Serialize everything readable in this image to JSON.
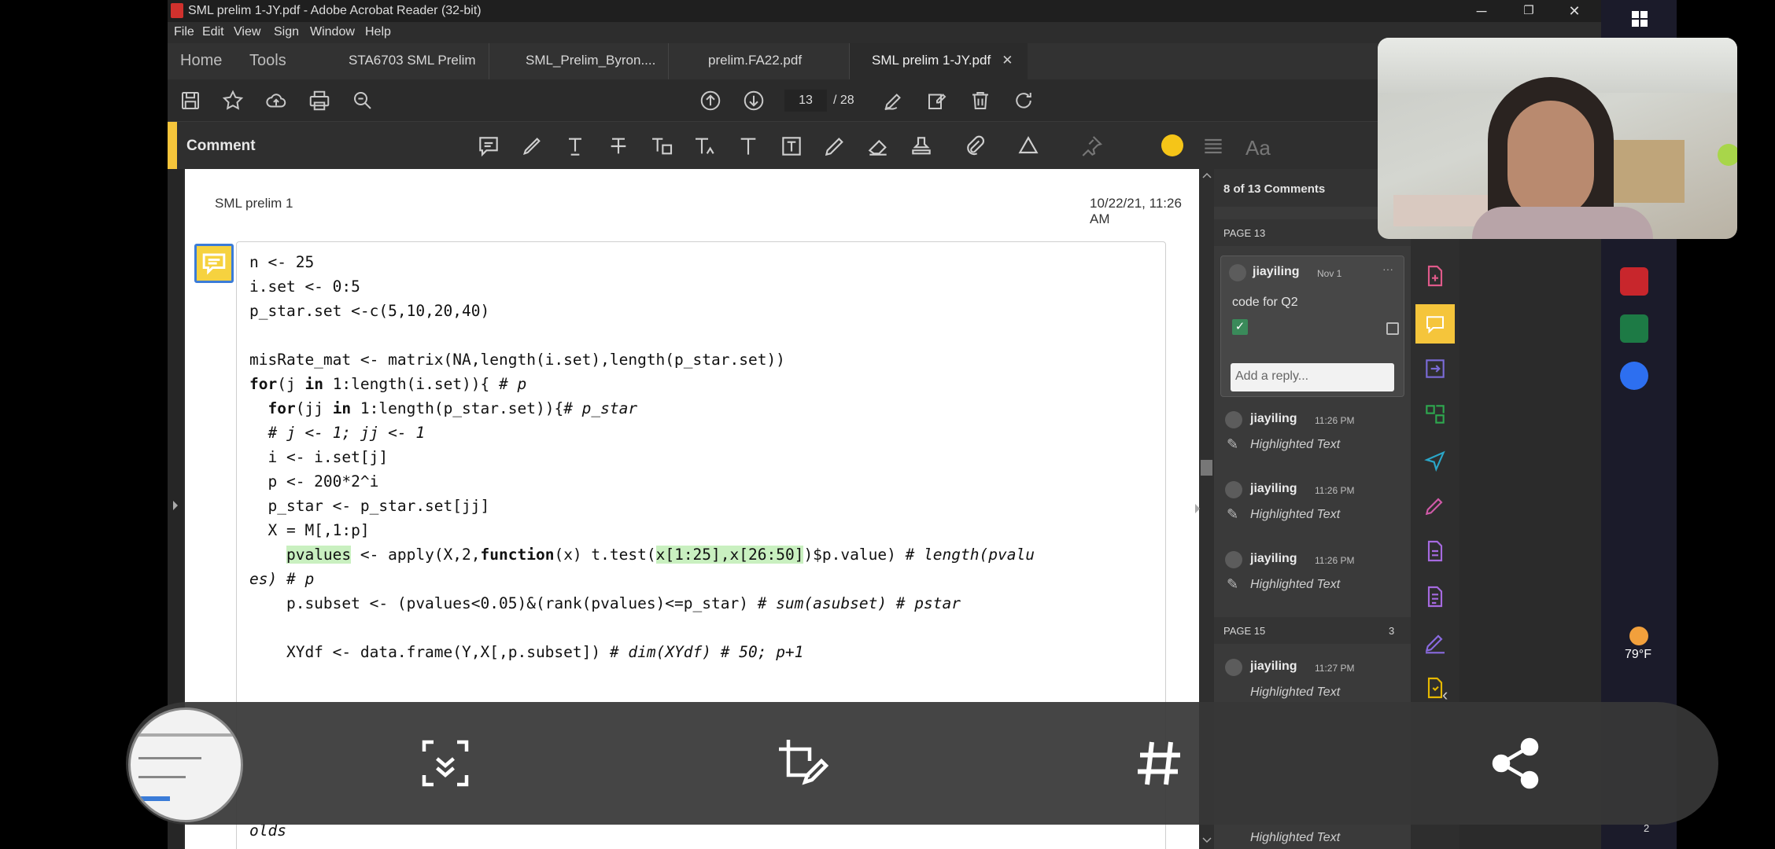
{
  "window": {
    "title": "SML prelim 1-JY.pdf - Adobe Acrobat Reader (32-bit)",
    "minimize": "─",
    "restore": "❐",
    "close": "✕"
  },
  "menu": [
    "File",
    "Edit",
    "View",
    "Sign",
    "Window",
    "Help"
  ],
  "nav": {
    "home": "Home",
    "tools": "Tools"
  },
  "tabs": [
    {
      "label": "STA6703 SML Prelim"
    },
    {
      "label": "SML_Prelim_Byron...."
    },
    {
      "label": "prelim.FA22.pdf"
    },
    {
      "label": "SML prelim 1-JY.pdf",
      "close": "✕"
    }
  ],
  "toolbar": {
    "page_current": "13",
    "page_total": "/ 28"
  },
  "comment_bar": {
    "label": "Comment",
    "font_label": "Aa",
    "active_color": "#f5c518"
  },
  "page": {
    "header_left": "SML prelim 1",
    "header_right": "10/22/21, 11:26 AM",
    "tail_text": "olds"
  },
  "code_lines": [
    "n <- 25",
    "i.set <- 0:5",
    "p_star.set <-c(5,10,20,40)",
    "",
    "misRate_mat <- matrix(NA,length(i.set),length(p_star.set))",
    "for(j in 1:length(i.set)){ # p",
    "  for(jj in 1:length(p_star.set)){# p_star",
    "  # j <- 1; jj <- 1",
    "  i <- i.set[j]",
    "  p <- 200*2^i",
    "  p_star <- p_star.set[jj]",
    "  X = M[,1:p]",
    "    pvalues <- apply(X,2,function(x) t.test(x[1:25],x[26:50])$p.value) # length(pvalu",
    "es) # p",
    "    p.subset <- (pvalues<0.05)&(rank(pvalues)<=p_star) # sum(asubset) # pstar",
    "",
    "    XYdf <- data.frame(Y,X[,p.subset]) # dim(XYdf) # 50; p+1"
  ],
  "comments_panel": {
    "header": "8 of 13 Comments",
    "section1": {
      "label": "PAGE 13"
    },
    "card": {
      "author": "jiayiling",
      "date": "Nov 1",
      "more": "···",
      "text": "code for Q2",
      "reply_placeholder": "Add a reply..."
    },
    "items": [
      {
        "author": "jiayiling",
        "time": "11:26 PM",
        "text": "Highlighted Text"
      },
      {
        "author": "jiayiling",
        "time": "11:26 PM",
        "text": "Highlighted Text"
      },
      {
        "author": "jiayiling",
        "time": "11:26 PM",
        "text": "Highlighted Text"
      }
    ],
    "section2": {
      "label": "PAGE 15",
      "count": "3"
    },
    "items2": [
      {
        "author": "jiayiling",
        "time": "11:27 PM",
        "text": "Highlighted Text"
      }
    ],
    "bottom_item": {
      "text": "Highlighted Text"
    }
  },
  "taskbar": {
    "temperature": "79°F",
    "badge": "2"
  }
}
